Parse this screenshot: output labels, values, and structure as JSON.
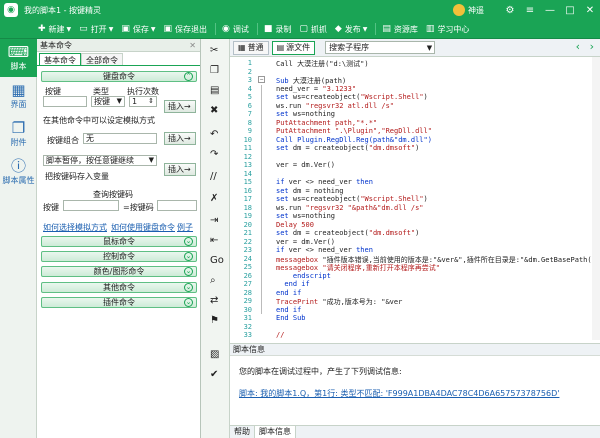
{
  "window": {
    "title": "我的脚本1 - 按键精灵",
    "user": "神遥"
  },
  "toolbar": [
    "新建",
    "打开",
    "保存",
    "保存退出",
    "调试",
    "录制",
    "抓抓",
    "发布",
    "资源库",
    "学习中心"
  ],
  "leftbar": [
    "脚本",
    "界面",
    "附件",
    "脚本属性"
  ],
  "panel": {
    "header": "基本命令",
    "tabs": [
      "基本命令",
      "全部命令"
    ],
    "keyboard": {
      "section": "键盘命令",
      "col_key": "按键",
      "col_type": "类型",
      "col_count": "执行次数",
      "type_value": "按键",
      "count_value": "1",
      "insert": "插入→",
      "target_text": "在其他命令中可以设定模拟方式",
      "combo_label": "按键组合",
      "combo_value": "无",
      "pause_label": "脚本暂停，按任意键继续",
      "store_label": "把按键码存入变量",
      "query_label": "查询按键码",
      "key_label": "按键",
      "keycode_label": "=按键码",
      "link1": "如何选择模拟方式",
      "link2": "如何使用键盘命令",
      "link3": "例子"
    },
    "sections": [
      "鼠标命令",
      "控制命令",
      "颜色/图形命令",
      "其他命令",
      "插件命令"
    ]
  },
  "editor": {
    "tab_normal": "普通",
    "tab_source": "源文件",
    "proc_select": "搜索子程序",
    "lines": [
      [
        {
          "t": "Call 大漠注册(\"d:\\测试\")"
        }
      ],
      [
        {
          "t": ""
        }
      ],
      [
        {
          "t": "Sub",
          "k": "kw"
        },
        {
          "t": " 大漠注册(path)"
        }
      ],
      [
        {
          "t": "need_ver = "
        },
        {
          "t": "\"3.1233\"",
          "k": "str"
        }
      ],
      [
        {
          "t": "set",
          "k": "kw"
        },
        {
          "t": " ws=createobject("
        },
        {
          "t": "\"Wscript.Shell\"",
          "k": "str"
        },
        {
          "t": ")"
        }
      ],
      [
        {
          "t": "ws.run "
        },
        {
          "t": "\"regsvr32 atl.dll /s\"",
          "k": "str"
        }
      ],
      [
        {
          "t": "set",
          "k": "kw"
        },
        {
          "t": " ws=nothing"
        }
      ],
      [
        {
          "t": "PutAttachment path,",
          "k": "str"
        },
        {
          "t": "\"*.*\"",
          "k": "str"
        }
      ],
      [
        {
          "t": "PutAttachment \".\\Plugin\",\"RegDll.dll\"",
          "k": "str"
        }
      ],
      [
        {
          "t": "Call Plugin.RegDll.Reg(path&\"dm.dll\")",
          "k": "kw"
        }
      ],
      [
        {
          "t": "set",
          "k": "kw"
        },
        {
          "t": " dm = createobject("
        },
        {
          "t": "\"dm.dmsoft\"",
          "k": "str"
        },
        {
          "t": ")"
        }
      ],
      [
        {
          "t": ""
        }
      ],
      [
        {
          "t": "ver = dm.Ver()"
        }
      ],
      [
        {
          "t": ""
        }
      ],
      [
        {
          "t": "if",
          "k": "kw"
        },
        {
          "t": " ver <> need_ver "
        },
        {
          "t": "then",
          "k": "kw"
        }
      ],
      [
        {
          "t": "set",
          "k": "kw"
        },
        {
          "t": " dm = nothing"
        }
      ],
      [
        {
          "t": "set",
          "k": "kw"
        },
        {
          "t": " ws=createobject("
        },
        {
          "t": "\"Wscript.Shell\"",
          "k": "str"
        },
        {
          "t": ")"
        }
      ],
      [
        {
          "t": "ws.run "
        },
        {
          "t": "\"regsvr32 \"&path&\"dm.dll /s\"",
          "k": "str"
        }
      ],
      [
        {
          "t": "set",
          "k": "kw"
        },
        {
          "t": " ws=nothing"
        }
      ],
      [
        {
          "t": "Delay 500",
          "k": "str"
        }
      ],
      [
        {
          "t": "set",
          "k": "kw"
        },
        {
          "t": " dm = createobject("
        },
        {
          "t": "\"dm.dmsoft\"",
          "k": "str"
        },
        {
          "t": ")"
        }
      ],
      [
        {
          "t": "ver = dm.Ver()"
        }
      ],
      [
        {
          "t": "if",
          "k": "kw"
        },
        {
          "t": " ver <> need_ver "
        },
        {
          "t": "then",
          "k": "kw"
        }
      ],
      [
        {
          "t": "messagebox",
          "k": "str"
        },
        {
          "t": " \"插件版本错误,当前使用的版本是:\"&ver&\",插件所在目录是:\"&dm.GetBasePath()"
        }
      ],
      [
        {
          "t": "messagebox",
          "k": "str"
        },
        {
          "t": " \"请关闭程序,重新打开本程序再尝试\"",
          "k": "str"
        }
      ],
      [
        {
          "t": "    endscript",
          "k": "kw"
        }
      ],
      [
        {
          "t": "  end if",
          "k": "kw"
        }
      ],
      [
        {
          "t": "end if",
          "k": "kw"
        }
      ],
      [
        {
          "t": "TracePrint",
          "k": "str"
        },
        {
          "t": " \"成功,版本号为: \"&ver"
        }
      ],
      [
        {
          "t": "end if",
          "k": "kw"
        }
      ],
      [
        {
          "t": "End Sub",
          "k": "kw"
        }
      ],
      [
        {
          "t": ""
        }
      ],
      [
        {
          "t": "//",
          "k": "str"
        }
      ]
    ]
  },
  "info": {
    "title": "脚本信息",
    "message": "您的脚本在调试过程中，产生了下列调试信息:",
    "error": "脚本: 我的脚本1.Q，第1行: 类型不匹配: 'F999A1DBA4DAC78C4D6A65757378756D'"
  },
  "bottom_tabs": [
    "帮助",
    "脚本信息"
  ]
}
